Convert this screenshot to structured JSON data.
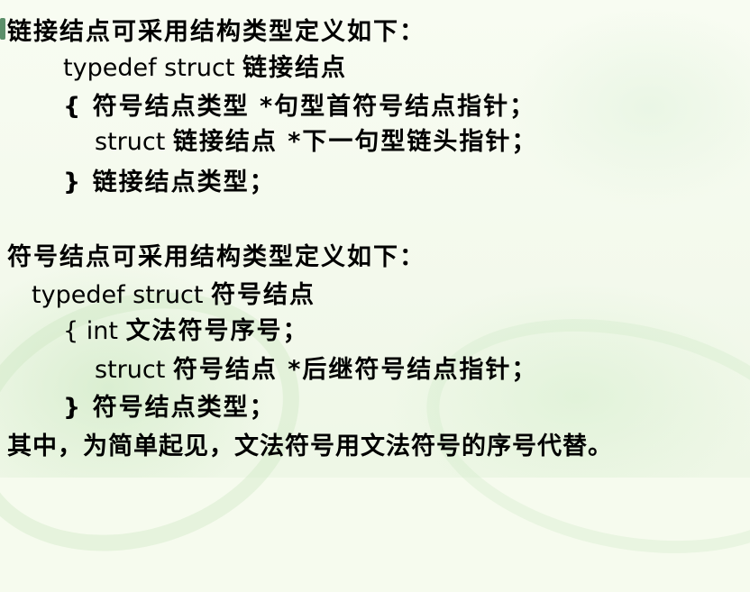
{
  "lines": [
    {
      "text": "链接结点可采用结构类型定义如下："
    },
    {
      "code": "typedef struct",
      "text": "链接结点"
    },
    {
      "text": "{ 符号结点类型 *句型首符号结点指针；"
    },
    {
      "code": "struct",
      "text": "链接结点 *下一句型链头指针；"
    },
    {
      "text": "} 链接结点类型；"
    },
    {
      "text": "符号结点可采用结构类型定义如下："
    },
    {
      "code": "typedef struct",
      "text": "符号结点"
    },
    {
      "code": "{  int",
      "text": "文法符号序号；"
    },
    {
      "code": "struct",
      "text": "符号结点 *后继符号结点指针；"
    },
    {
      "text": "} 符号结点类型；"
    },
    {
      "text": "其中，为简单起见，文法符号用文法符号的序号代替。"
    }
  ]
}
